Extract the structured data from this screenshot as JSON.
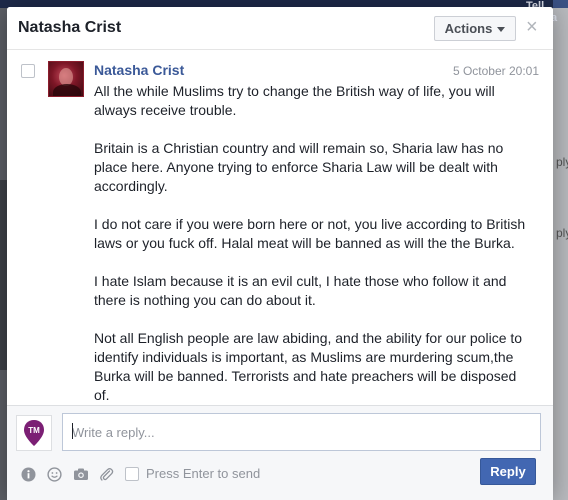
{
  "background": {
    "right_label_top": "Tell Mama",
    "right_fragment_1": "ply",
    "right_fragment_2": "ply"
  },
  "dialog": {
    "title": "Natasha Crist",
    "actions_label": "Actions",
    "close_glyph": "×"
  },
  "message": {
    "sender": "Natasha Crist",
    "timestamp": "5 October 20:01",
    "paragraphs": [
      "All the while Muslims try to change the British way of life, you will always receive trouble.",
      "Britain is a Christian country and will remain so, Sharia law has no place here. Anyone trying to enforce Sharia Law will be dealt with accordingly.",
      "I do not care if you were born here or not, you live according to British laws or you fuck off. Halal meat will be banned as will the the Burka.",
      "I hate Islam because it is an evil cult, I hate those who follow it and there is nothing you can do about it.",
      "Not all English people are law abiding, and the ability for our police to identify individuals is important, as Muslims are murdering scum,the Burka will be banned. Terrorists and hate preachers will be disposed of."
    ]
  },
  "composer": {
    "page_avatar_text": "TM",
    "reply_placeholder": "Write a reply...",
    "press_enter_label": "Press Enter to send",
    "reply_button_label": "Reply"
  },
  "colors": {
    "accent": "#4267b2",
    "link": "#3b5998",
    "tm_purple": "#7b1f74"
  },
  "icons": [
    "info-icon",
    "emoji-icon",
    "camera-icon",
    "attachment-icon",
    "close-icon",
    "chevron-down-icon"
  ]
}
